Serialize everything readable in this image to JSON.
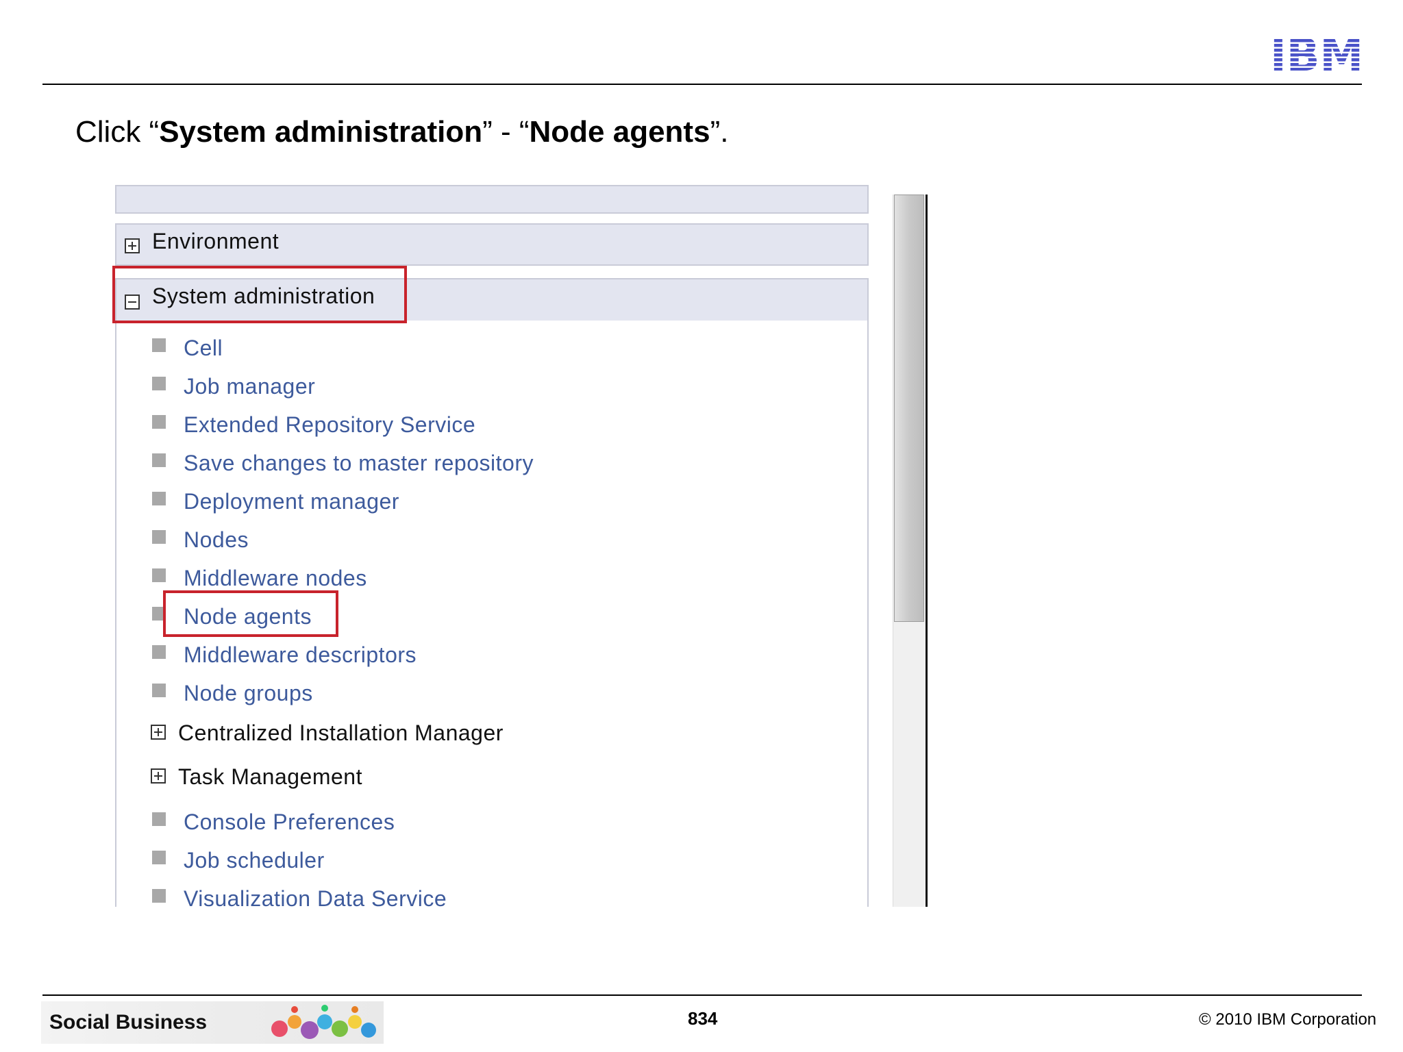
{
  "header": {
    "logo_text": "IBM",
    "instruction_prefix": "Click “",
    "instruction_bold1": "System administration",
    "instruction_mid": "” - “",
    "instruction_bold2": "Node agents",
    "instruction_suffix": "”."
  },
  "console": {
    "sections": [
      {
        "label": "Environment",
        "state": "collapsed",
        "icon": "plus-box-icon"
      },
      {
        "label": "System administration",
        "state": "expanded",
        "icon": "minus-box-icon"
      }
    ],
    "items": [
      {
        "label": "Cell",
        "type": "link"
      },
      {
        "label": "Job manager",
        "type": "link"
      },
      {
        "label": "Extended Repository Service",
        "type": "link"
      },
      {
        "label": "Save changes to master repository",
        "type": "link"
      },
      {
        "label": "Deployment manager",
        "type": "link"
      },
      {
        "label": "Nodes",
        "type": "link"
      },
      {
        "label": "Middleware nodes",
        "type": "link"
      },
      {
        "label": "Node agents",
        "type": "link",
        "highlighted": true
      },
      {
        "label": "Middleware descriptors",
        "type": "link"
      },
      {
        "label": "Node groups",
        "type": "link"
      },
      {
        "label": "Centralized Installation Manager",
        "type": "group"
      },
      {
        "label": "Task Management",
        "type": "group"
      },
      {
        "label": "Console Preferences",
        "type": "link"
      },
      {
        "label": "Job scheduler",
        "type": "link"
      },
      {
        "label": "Visualization Data Service",
        "type": "link"
      }
    ],
    "highlight_color": "#c8232c",
    "link_color": "#3d5a9c",
    "header_bg": "#e3e5f0"
  },
  "footer": {
    "banner_text": "Social Business",
    "page_number": "834",
    "copyright": "© 2010 IBM Corporation"
  }
}
